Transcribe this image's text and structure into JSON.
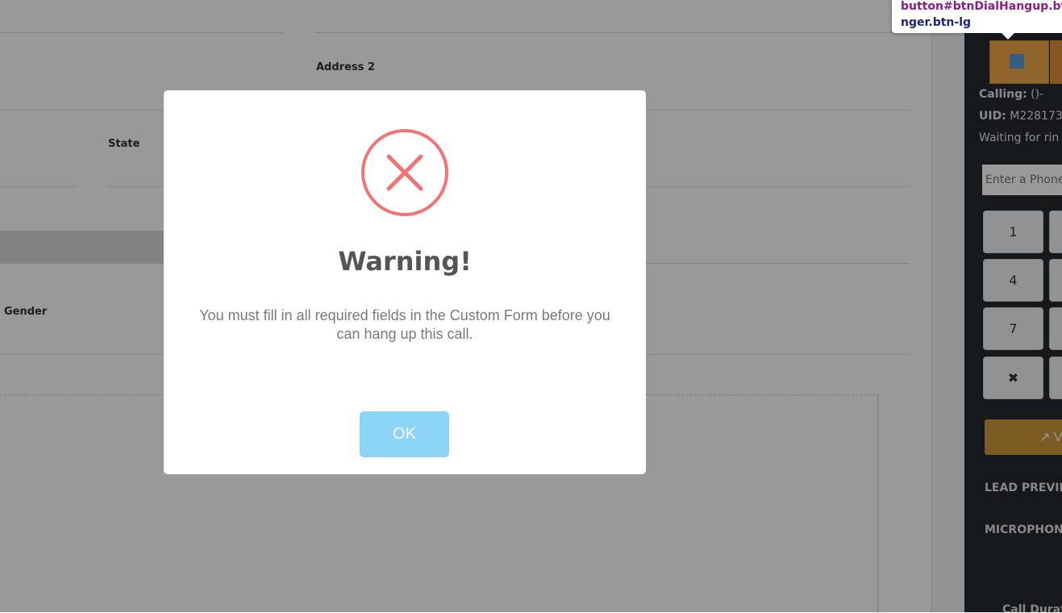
{
  "form": {
    "address2_label": "Address 2",
    "state_label": "State",
    "gender_label": "Gender"
  },
  "sidebar": {
    "calling_label": "Calling:",
    "calling_value": "()-",
    "uid_label": "UID:",
    "uid_value": "M228173",
    "status_text": "Waiting for rin",
    "phone_placeholder": "Enter a Phone",
    "dialpad": {
      "k1": "1",
      "k4": "4",
      "k7": "7",
      "kclear": "✖"
    },
    "open_button_label": "↗ V",
    "lead_preview_heading": "LEAD PREVIE",
    "microphone_heading": "MICROPHON",
    "call_duration_label": "Call Durat",
    "hangup_color": "#f0a84a"
  },
  "tooltip": {
    "line1": "button#btnDialHangup.bt",
    "line2": "nger.btn-lg"
  },
  "modal": {
    "icon": "error-x-icon",
    "icon_color": "#f27474",
    "title": "Warning!",
    "message": "You must fill in all required fields in the Custom Form before you can hang up this call.",
    "ok_label": "OK",
    "ok_color": "#8cd4f5"
  }
}
